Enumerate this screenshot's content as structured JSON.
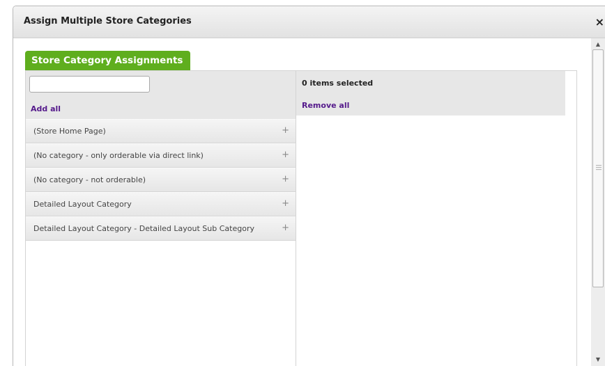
{
  "dialog": {
    "title": "Assign Multiple Store Categories",
    "close_glyph": "×"
  },
  "tab": {
    "label": "Store Category Assignments"
  },
  "available": {
    "search_value": "",
    "add_all_label": "Add all",
    "add_glyph": "+",
    "items": [
      {
        "label": "(Store Home Page)"
      },
      {
        "label": "(No category - only orderable via direct link)"
      },
      {
        "label": "(No category - not orderable)"
      },
      {
        "label": "Detailed Layout Category"
      },
      {
        "label": "Detailed Layout Category - Detailed Layout Sub Category"
      }
    ]
  },
  "selected": {
    "count_text": "0 items selected",
    "remove_all_label": "Remove all"
  },
  "scrollbar": {
    "up_glyph": "▲",
    "down_glyph": "▼"
  }
}
